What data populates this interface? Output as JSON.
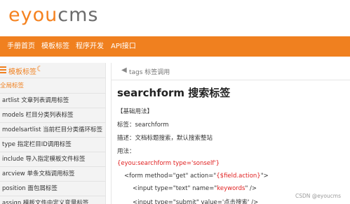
{
  "logo": {
    "part1": "eyou",
    "part2": "cms"
  },
  "nav": {
    "items": [
      "手册首页",
      "模板标签",
      "程序开发",
      "API接口"
    ]
  },
  "sidebar": {
    "title": "模板标签",
    "items": [
      "全局标签",
      "artlist 文章列表调用标签",
      "models 栏目分类列表标签",
      "modelsartlist 当前栏目分类循环标签",
      "type 指定栏目ID调用标签",
      "include 导入指定模板文件标签",
      "arcview 单条文档调用标签",
      "position 面包屑标签",
      "assign 模板文件中定义变量标签"
    ]
  },
  "breadcrumb": {
    "text": "tags 标签调用"
  },
  "article": {
    "title": "searchform 搜索标签",
    "section": "【基础用法】",
    "tag_line": "标签：searchform",
    "desc_line": "描述：文档标题搜索，默认搜索整站",
    "usage_label": "用法：",
    "code_open": "{eyou:searchform type='sonself'}",
    "form_pre": "<form method=\"get\" action=\"",
    "form_val": "{$field.action}",
    "form_post": "\">",
    "input1_pre": "<input type=\"text\" name=\"",
    "input1_val": "keywords",
    "input1_post": "\" />",
    "input2": "<input type=\"submit\" value='点击搜索' />"
  },
  "watermark": "CSDN @eyoucms"
}
